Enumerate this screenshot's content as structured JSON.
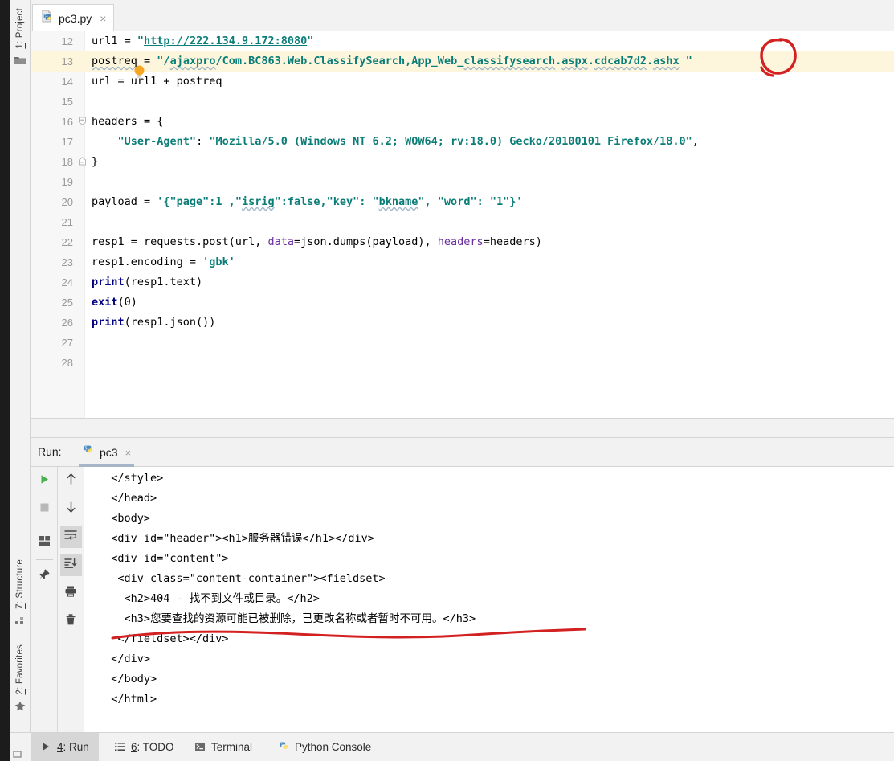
{
  "window": {
    "left_tool_tabs": [
      {
        "num": "1",
        "label": ": Project",
        "icon": "folder-icon"
      },
      {
        "num": "7",
        "label": ": Structure",
        "icon": "structure-icon"
      },
      {
        "num": "2",
        "label": ": Favorites",
        "icon": "star-icon"
      }
    ]
  },
  "editor": {
    "tab": {
      "filename": "pc3.py",
      "close": "×",
      "icon": "python-file-icon"
    },
    "highlighted_line": 13,
    "lines": [
      {
        "no": "12",
        "text": "url1 = \"http://222.134.9.172:8080\""
      },
      {
        "no": "13",
        "text": "postreq = \"/ajaxpro/Com.BC863.Web.ClassifySearch,App_Web_classifysearch.aspx.cdcab7d2.ashx \""
      },
      {
        "no": "14",
        "text": "url = url1 + postreq"
      },
      {
        "no": "15",
        "text": ""
      },
      {
        "no": "16",
        "text": "headers = {"
      },
      {
        "no": "17",
        "text": "    \"User-Agent\": \"Mozilla/5.0 (Windows NT 6.2; WOW64; rv:18.0) Gecko/20100101 Firefox/18.0\","
      },
      {
        "no": "18",
        "text": "}"
      },
      {
        "no": "19",
        "text": ""
      },
      {
        "no": "20",
        "text": "payload = '{\"page\":1 ,\"isrig\":false,\"key\": \"bkname\", \"word\": \"1\"}'"
      },
      {
        "no": "21",
        "text": ""
      },
      {
        "no": "22",
        "text": "resp1 = requests.post(url, data=json.dumps(payload), headers=headers)"
      },
      {
        "no": "23",
        "text": "resp1.encoding = 'gbk'"
      },
      {
        "no": "24",
        "text": "print(resp1.text)"
      },
      {
        "no": "25",
        "text": "exit(0)"
      },
      {
        "no": "26",
        "text": "print(resp1.json())"
      },
      {
        "no": "27",
        "text": ""
      },
      {
        "no": "28",
        "text": ""
      }
    ]
  },
  "run_panel": {
    "label": "Run:",
    "tab_name": "pc3",
    "tab_close": "×",
    "toolbar_left": [
      {
        "name": "rerun-button",
        "icon": "play-icon"
      },
      {
        "name": "stop-button",
        "icon": "stop-icon"
      },
      {
        "name": "restore-layout-button",
        "icon": "layout-icon"
      },
      {
        "name": "pin-tab-button",
        "icon": "pin-icon"
      }
    ],
    "toolbar_right": [
      {
        "name": "up-stacktrace-button",
        "icon": "arrow-up-icon"
      },
      {
        "name": "down-stacktrace-button",
        "icon": "arrow-down-icon"
      },
      {
        "name": "soft-wrap-button",
        "icon": "soft-wrap-icon"
      },
      {
        "name": "scroll-to-end-button",
        "icon": "scroll-end-icon"
      },
      {
        "name": "print-button",
        "icon": "printer-icon"
      },
      {
        "name": "clear-all-button",
        "icon": "trash-icon"
      }
    ],
    "output_lines": [
      "  </style>",
      "  </head>",
      "  <body>",
      "  <div id=\"header\"><h1>服务器错误</h1></div>",
      "  <div id=\"content\">",
      "   <div class=\"content-container\"><fieldset>",
      "    <h2>404 - 找不到文件或目录。</h2>",
      "    <h3>您要查找的资源可能已被删除，已更改名称或者暂时不可用。</h3>",
      "   </fieldset></div>",
      "  </div>",
      "  </body>",
      "  </html>"
    ]
  },
  "status_bar": {
    "tabs": [
      {
        "num": "4",
        "label": ": Run",
        "icon": "play-icon",
        "selected": true
      },
      {
        "num": "6",
        "label": ": TODO",
        "icon": "todo-icon",
        "selected": false
      },
      {
        "num": "",
        "label": "Terminal",
        "icon": "terminal-icon",
        "selected": false
      },
      {
        "num": "",
        "label": "Python Console",
        "icon": "python-icon",
        "selected": false
      }
    ]
  },
  "annotations": {
    "circle": {
      "target": "closing-quote-on-line-13",
      "color": "#d32020"
    },
    "underline": {
      "target": "h3-chinese-error-line",
      "color": "#d32020"
    }
  },
  "colors": {
    "string": "#0a7d77",
    "keyword": "#000080",
    "named_arg": "#6a2fa0",
    "highlight_line": "#fdf6dd",
    "annotation_red": "#d32020",
    "panel_bg": "#f2f2f2"
  }
}
